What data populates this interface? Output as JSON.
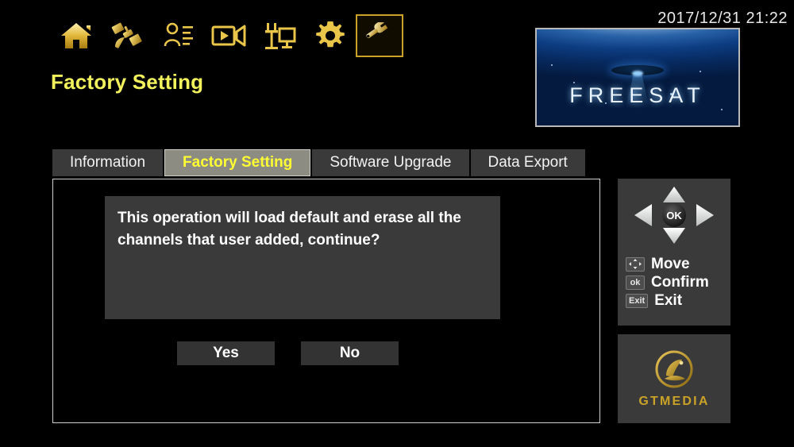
{
  "header": {
    "clock": "2017/12/31  21:22",
    "page_title": "Factory Setting",
    "nav_icons": [
      {
        "name": "home-icon",
        "label": "Home"
      },
      {
        "name": "satellite-icon",
        "label": "Installation"
      },
      {
        "name": "channel-list-icon",
        "label": "Channel"
      },
      {
        "name": "media-video-icon",
        "label": "Media"
      },
      {
        "name": "antenna-tv-icon",
        "label": "Network"
      },
      {
        "name": "gear-icon",
        "label": "Settings"
      },
      {
        "name": "wrench-icon",
        "label": "Tools"
      }
    ],
    "selected_nav_index": 6
  },
  "preview": {
    "brand": "FREESAT"
  },
  "tabs": [
    {
      "label": "Information",
      "active": false
    },
    {
      "label": "Factory Setting",
      "active": true
    },
    {
      "label": "Software Upgrade",
      "active": false
    },
    {
      "label": "Data Export",
      "active": false
    }
  ],
  "dialog": {
    "message": "This operation will load default and erase all the channels that user added, continue?",
    "yes_label": "Yes",
    "no_label": "No"
  },
  "help": {
    "rows": [
      {
        "key": "arrows",
        "key_text": "",
        "label": "Move"
      },
      {
        "key": "ok",
        "key_text": "ok",
        "label": "Confirm"
      },
      {
        "key": "exit",
        "key_text": "Exit",
        "label": "Exit"
      }
    ],
    "dpad_ok_label": "OK"
  },
  "logo": {
    "wordmark": "GTMEDIA"
  },
  "colors": {
    "gold": "#c9a227",
    "title_yellow": "#f2f25c",
    "active_tab_text": "#ffff33",
    "panel_gray": "#3a3a3a",
    "background": "#000000"
  }
}
